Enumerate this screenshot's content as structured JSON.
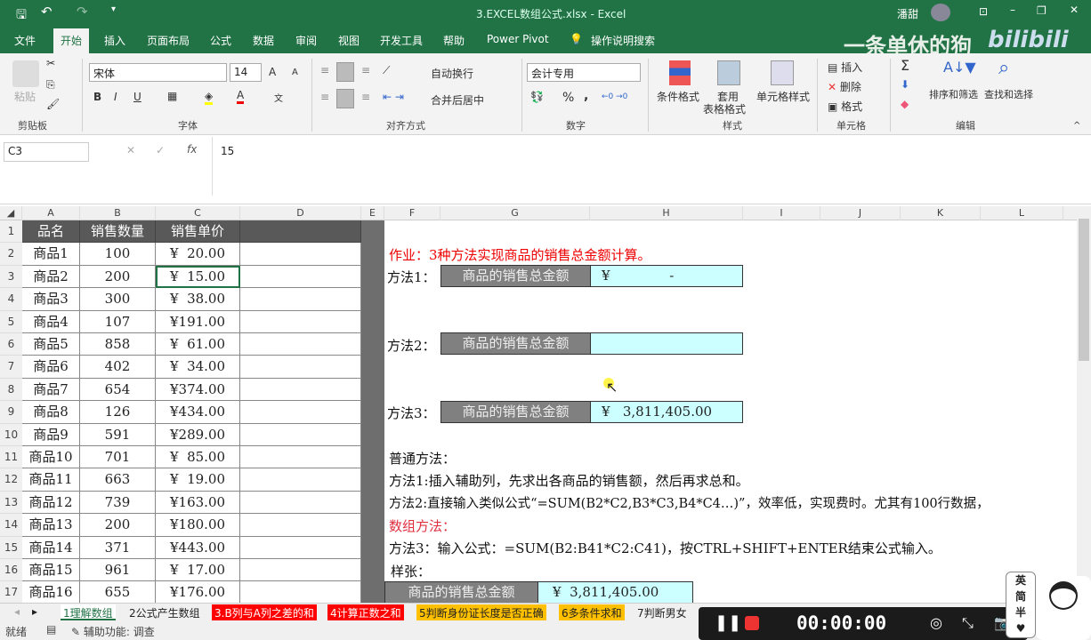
{
  "title": "3.EXCEL数组公式.xlsx - Excel",
  "user": "潘甜",
  "watermark": "一条单休的狗",
  "tabs": [
    "文件",
    "开始",
    "插入",
    "页面布局",
    "公式",
    "数据",
    "审阅",
    "视图",
    "开发工具",
    "帮助",
    "Power Pivot",
    "操作说明搜索"
  ],
  "ribbon": {
    "paste": "粘贴",
    "clipboard": "剪贴板",
    "font_name": "宋体",
    "font_size": "14",
    "bold": "B",
    "italic": "I",
    "underline": "U",
    "font": "字体",
    "wrap": "自动换行",
    "merge": "合并后居中",
    "align": "对齐方式",
    "numfmt": "会计专用",
    "percent": "%",
    "comma": ",",
    "number": "数字",
    "cond": "条件格式",
    "table1": "套用",
    "table2": "表格格式",
    "cellstyle": "单元格样式",
    "styles": "样式",
    "insert": "插入",
    "delete": "删除",
    "format": "格式",
    "cells": "单元格",
    "sum": "Σ",
    "sort": "排序和筛选",
    "find": "查找和选择",
    "editing": "编辑"
  },
  "formula_bar": {
    "name_box": "C3",
    "fx": "fx",
    "value": "15"
  },
  "columns": [
    "A",
    "B",
    "C",
    "D",
    "E",
    "F",
    "G",
    "H",
    "I",
    "J",
    "K",
    "L"
  ],
  "header_row": [
    "品名",
    "销售数量",
    "销售单价"
  ],
  "rows": [
    [
      "商品1",
      "100",
      "¥  20.00"
    ],
    [
      "商品2",
      "200",
      "¥  15.00"
    ],
    [
      "商品3",
      "300",
      "¥  38.00"
    ],
    [
      "商品4",
      "107",
      "¥191.00"
    ],
    [
      "商品5",
      "858",
      "¥  61.00"
    ],
    [
      "商品6",
      "402",
      "¥  34.00"
    ],
    [
      "商品7",
      "654",
      "¥374.00"
    ],
    [
      "商品8",
      "126",
      "¥434.00"
    ],
    [
      "商品9",
      "591",
      "¥289.00"
    ],
    [
      "商品10",
      "701",
      "¥  85.00"
    ],
    [
      "商品11",
      "663",
      "¥  19.00"
    ],
    [
      "商品12",
      "739",
      "¥163.00"
    ],
    [
      "商品13",
      "200",
      "¥180.00"
    ],
    [
      "商品14",
      "371",
      "¥443.00"
    ],
    [
      "商品15",
      "961",
      "¥  17.00"
    ],
    [
      "商品16",
      "655",
      "¥176.00"
    ]
  ],
  "right": {
    "homework": "作业：3种方法实现商品的销售总金额计算。",
    "m1": "方法1：",
    "m2": "方法2：",
    "m3": "方法3：",
    "label": "商品的销售总金额",
    "v1": "¥              -",
    "v2": "",
    "v3": "¥   3,811,405.00",
    "normal": "普通方法：",
    "n1": "方法1:插入辅助列，先求出各商品的销售额，然后再求总和。",
    "n2": "方法2:直接输入类似公式“=SUM(B2*C2,B3*C3,B4*C4…)”，效率低，实现费时。尤其有100行数据，",
    "array": "数组方法：",
    "n3": "方法3：输入公式：=SUM(B2:B41*C2:C41)，按CTRL+SHIFT+ENTER结束公式输入。",
    "sample": "样张：",
    "sample_val": "¥  3,811,405.00"
  },
  "sheets": [
    "1理解数组",
    "2公式产生数组",
    "3.B列与A列之差的和",
    "4计算正数之和",
    "5判断身份证长度是否正确",
    "6多条件求和",
    "7判断男女"
  ],
  "status": {
    "ready": "就绪",
    "access": "辅助功能: 调查"
  },
  "recorder": {
    "time": "00:00:00"
  },
  "ime": [
    "英",
    "简",
    "半"
  ]
}
